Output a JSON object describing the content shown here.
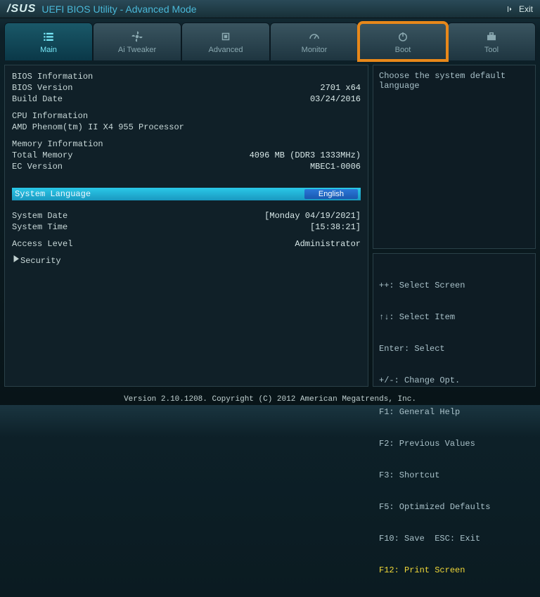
{
  "topbar": {
    "logo": "/SUS",
    "title": "UEFI BIOS Utility - Advanced Mode",
    "exit": "Exit"
  },
  "tabs": [
    "Main",
    "Ai Tweaker",
    "Advanced",
    "Monitor",
    "Boot",
    "Tool"
  ],
  "info": {
    "bios_info_h": "BIOS Information",
    "bios_version_k": "BIOS Version",
    "bios_version_v": "2701 x64",
    "build_date_k": "Build Date",
    "build_date_v": "03/24/2016",
    "cpu_info_h": "CPU Information",
    "cpu_name": "AMD Phenom(tm) II X4 955 Processor",
    "mem_info_h": "Memory Information",
    "total_mem_k": "Total Memory",
    "total_mem_v": "4096 MB (DDR3 1333MHz)",
    "ec_k": "EC Version",
    "ec_v": "MBEC1-0006",
    "lang_k": "System Language",
    "lang_v": "English",
    "date_k": "System Date",
    "date_v": "[Monday 04/19/2021]",
    "time_k": "System Time",
    "time_v": "[15:38:21]",
    "access_k": "Access Level",
    "access_v": "Administrator",
    "security": "Security"
  },
  "right": {
    "desc": "Choose the system default language"
  },
  "help": {
    "l1": "++: Select Screen",
    "l2": "↑↓: Select Item",
    "l3": "Enter: Select",
    "l4": "+/-: Change Opt.",
    "l5": "F1: General Help",
    "l6": "F2: Previous Values",
    "l7": "F3: Shortcut",
    "l8": "F5: Optimized Defaults",
    "l9": "F10: Save  ESC: Exit",
    "l10": "F12: Print Screen"
  },
  "footer": "Version 2.10.1208. Copyright (C) 2012 American Megatrends, Inc."
}
